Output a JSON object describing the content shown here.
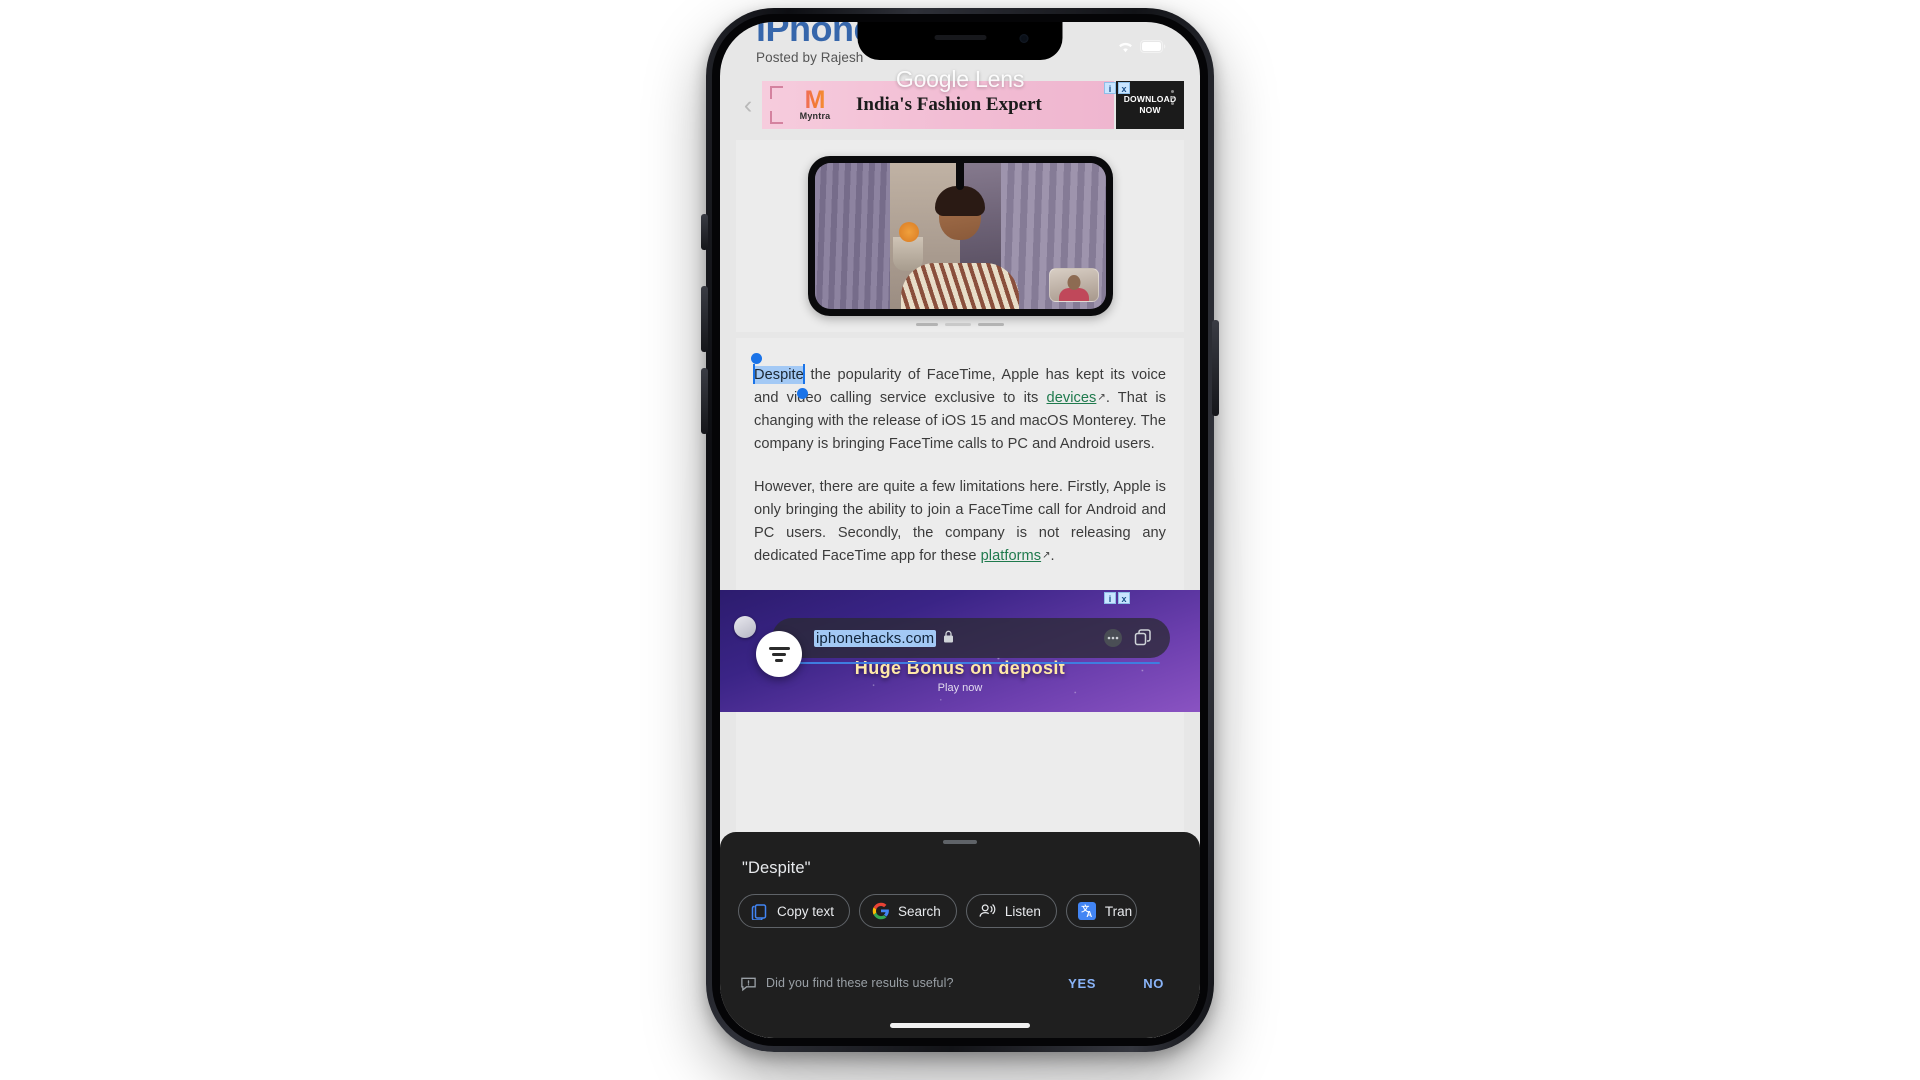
{
  "status_bar": {
    "time": "",
    "wifi_icon": "wifi-icon",
    "battery_icon": "battery-icon"
  },
  "article": {
    "site_title": "iPhoneHacks",
    "byline": "Posted by Rajesh",
    "paragraph1_pre": "",
    "selected_word": "Despite",
    "paragraph1_a": " the popularity of FaceTime, Apple has kept its voice and video calling service exclusive to its ",
    "link1": "devices",
    "paragraph1_b": ". That is changing with the release of iOS 15 and macOS Monterey. The company is bringing FaceTime calls to PC and Android users.",
    "paragraph2_a": "However, there are quite a few limitations here. Firstly, Apple is only bringing the ability to join a FaceTime call for Android and PC users. Secondly, the company is not releasing any dedicated FaceTime app for these ",
    "link2": "platforms",
    "paragraph2_b": ".",
    "external_link_icon": "external-link-icon"
  },
  "top_ad": {
    "prev_icon": "chevron-left-icon",
    "brand": "Myntra",
    "brand_mark": "M",
    "headline": "India's Fashion Expert",
    "cta_line1": "DOWNLOAD",
    "cta_line2": "NOW",
    "info_badge": "i",
    "close_badge": "x",
    "kebab_icon": "more-options-icon"
  },
  "lens_watermark": "Google Lens",
  "hero": {
    "caption_icon": "facetime-screenshot"
  },
  "bottom_ad": {
    "headline": "Huge Bonus on deposit",
    "subline": "Play now",
    "info_badge": "i",
    "close_badge": "x"
  },
  "omnibox": {
    "url": "iphonehacks.com",
    "lock_icon": "lock-icon",
    "tabs_icon": "tabs-icon",
    "menu_icon": "more-menu-icon",
    "lens_fab_icon": "lens-filter-icon"
  },
  "sheet": {
    "query": "\"Despite\"",
    "actions": [
      {
        "label": "Copy text",
        "icon": "copy-text-icon"
      },
      {
        "label": "Search",
        "icon": "google-g-icon"
      },
      {
        "label": "Listen",
        "icon": "listen-icon"
      },
      {
        "label": "Tran",
        "icon": "translate-icon"
      }
    ],
    "feedback": {
      "icon": "feedback-icon",
      "prompt": "Did you find these results useful?",
      "yes": "YES",
      "no": "NO"
    }
  },
  "colors": {
    "selection_blue": "#a3c9f5",
    "handle_blue": "#1a73e8",
    "link_green": "#1f7a4d",
    "sheet_bg": "#1f1f1f",
    "chip_border": "#5f6368",
    "action_blue": "#8ab4f8"
  }
}
